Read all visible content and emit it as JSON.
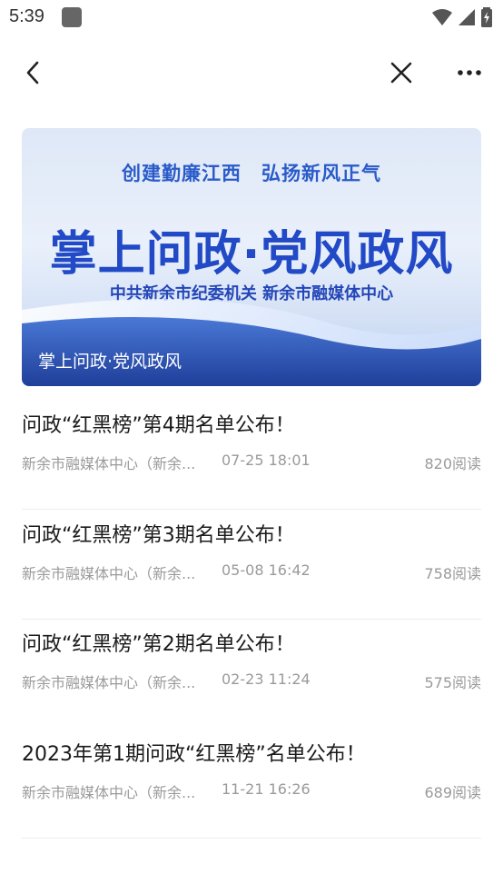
{
  "status_bar": {
    "time": "5:39"
  },
  "banner": {
    "slogan": "创建勤廉江西　弘扬新风正气",
    "heading": "掌上问政·党风政风",
    "org": "中共新余市纪委机关 新余市融媒体中心",
    "caption": "掌上问政·党风政风"
  },
  "articles": [
    {
      "title": "问政“红黑榜”第4期名单公布！",
      "source": "新余市融媒体中心（新余...",
      "time": "07-25 18:01",
      "reads": "820阅读"
    },
    {
      "title": "问政“红黑榜”第3期名单公布！",
      "source": "新余市融媒体中心（新余...",
      "time": "05-08 16:42",
      "reads": "758阅读"
    },
    {
      "title": "问政“红黑榜”第2期名单公布！",
      "source": "新余市融媒体中心（新余...",
      "time": "02-23 11:24",
      "reads": "575阅读"
    },
    {
      "title": "2023年第1期问政“红黑榜”名单公布！",
      "source": "新余市融媒体中心（新余...",
      "time": "11-21 16:26",
      "reads": "689阅读"
    }
  ]
}
